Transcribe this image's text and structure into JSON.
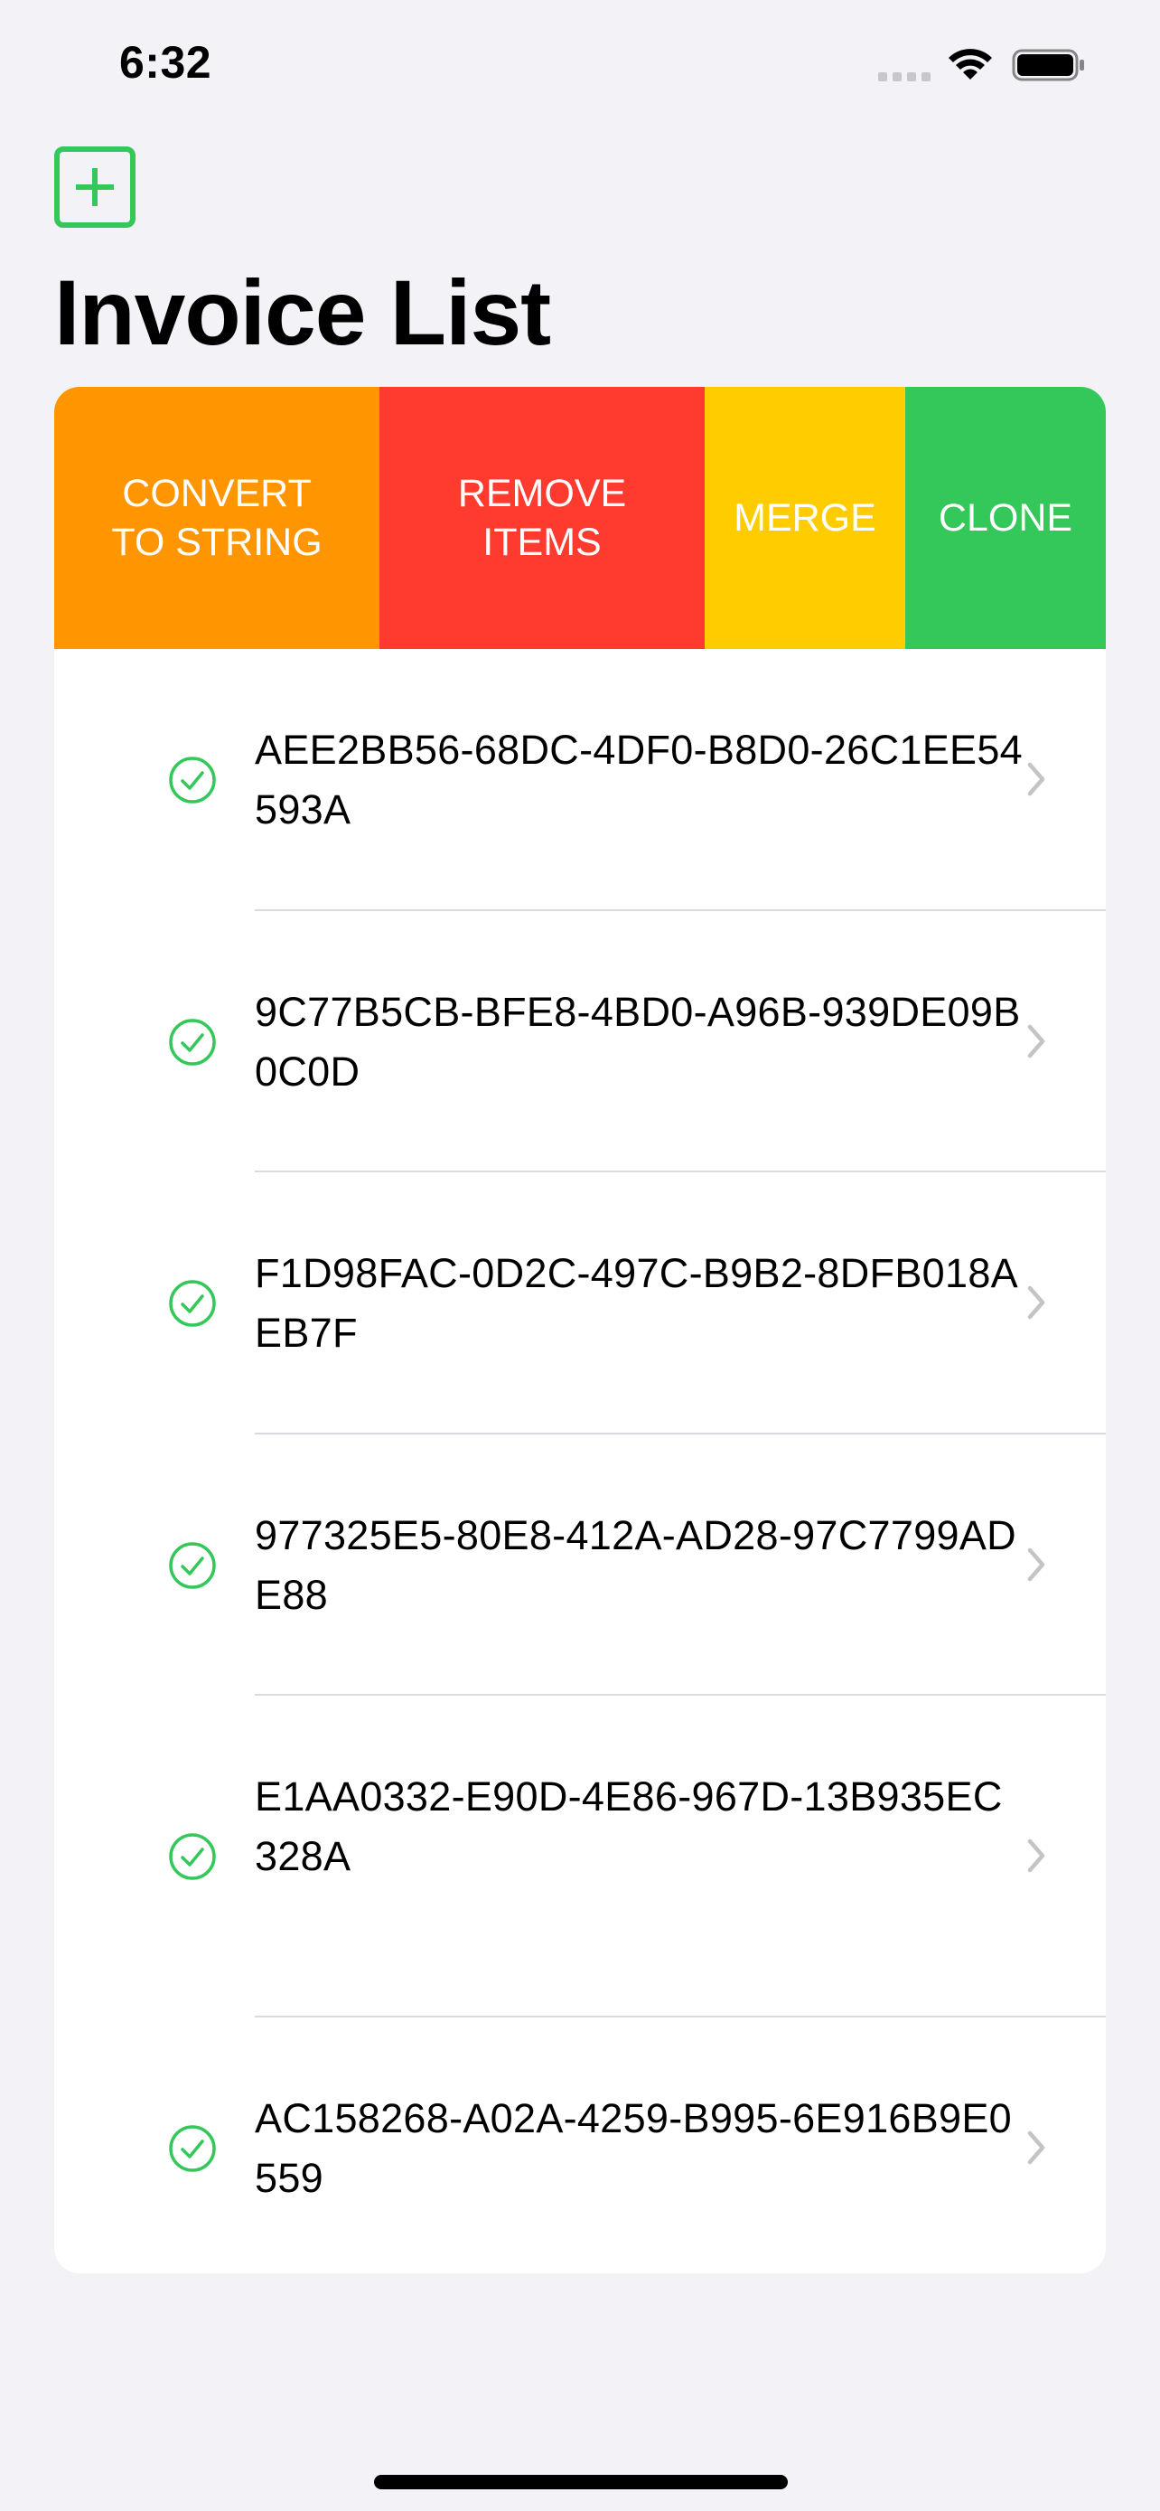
{
  "status_bar": {
    "time": "6:32",
    "icons": [
      "signal-dots-icon",
      "wifi-icon",
      "battery-icon"
    ]
  },
  "header": {
    "add_icon": "plus-square-icon",
    "title": "Invoice List"
  },
  "swipe_actions": [
    {
      "label": "CONVERT\nTO STRING",
      "color": "#ff9500"
    },
    {
      "label": "REMOVE\nITEMS",
      "color": "#ff3b30"
    },
    {
      "label": "MERGE",
      "color": "#ffcc00"
    },
    {
      "label": "CLONE",
      "color": "#34c759"
    }
  ],
  "invoices": [
    {
      "id": "AEE2BB56-68DC-4DF0-B8D0-26C1EE54593A",
      "status_icon": "checkmark-circle-icon"
    },
    {
      "id": "9C77B5CB-BFE8-4BD0-A96B-939DE09B0C0D",
      "status_icon": "checkmark-circle-icon"
    },
    {
      "id": "F1D98FAC-0D2C-497C-B9B2-8DFB018AEB7F",
      "status_icon": "checkmark-circle-icon"
    },
    {
      "id": "977325E5-80E8-412A-AD28-97C7799ADE88",
      "status_icon": "checkmark-circle-icon"
    },
    {
      "id": "E1AA0332-E90D-4E86-967D-13B935EC328A",
      "status_icon": "checkmark-circle-icon"
    },
    {
      "id": "AC158268-A02A-4259-B995-6E916B9E0559",
      "status_icon": "checkmark-circle-icon"
    }
  ],
  "colors": {
    "accent_green": "#34c759",
    "background": "#f2f2f7",
    "chevron": "#c4c4c6"
  }
}
